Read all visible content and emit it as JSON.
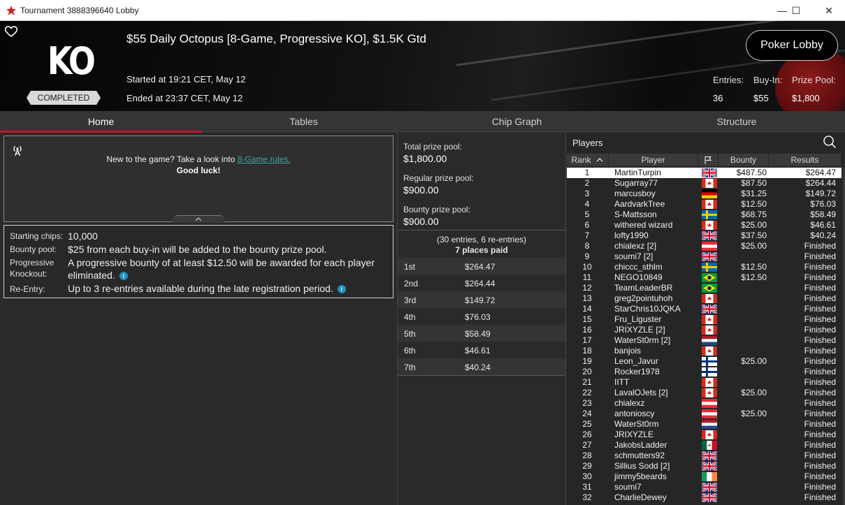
{
  "window": {
    "title": "Tournament 3888396640 Lobby",
    "minimize": "—",
    "maximize": "☐",
    "close": "✕"
  },
  "header": {
    "logo_text": "KO",
    "status": "COMPLETED",
    "tournament_name": "$55 Daily Octopus [8-Game, Progressive KO], $1.5K Gtd",
    "started": "Started at 19:21 CET, May 12",
    "ended": "Ended at 23:37 CET, May 12",
    "lobby_button": "Poker Lobby",
    "stats": [
      {
        "label": "Entries:",
        "value": "36"
      },
      {
        "label": "Buy-In:",
        "value": "$55"
      },
      {
        "label": "Prize Pool:",
        "value": "$1,800"
      }
    ]
  },
  "tabs": [
    {
      "label": "Home",
      "active": true
    },
    {
      "label": "Tables",
      "active": false
    },
    {
      "label": "Chip Graph",
      "active": false
    },
    {
      "label": "Structure",
      "active": false
    }
  ],
  "info": {
    "text_before": "New to the game? Take a look into ",
    "link": "8-Game rules.",
    "good_luck": "Good luck!"
  },
  "details": {
    "starting_chips_label": "Starting chips:",
    "starting_chips": "10,000",
    "bounty_pool_label": "Bounty pool:",
    "bounty_pool": "$25 from each buy-in will be added to the bounty prize pool.",
    "pko_label_1": "Progressive",
    "pko_label_2": "Knockout:",
    "pko_line1": "A progressive bounty of at least $12.50 will be awarded for each player",
    "pko_line2": "eliminated.",
    "reentry_label": "Re-Entry:",
    "reentry": "Up to 3 re-entries available during the late registration period.",
    "info_glyph": "i"
  },
  "prize": {
    "total_label": "Total prize pool:",
    "total": "$1,800.00",
    "regular_label": "Regular prize pool:",
    "regular": "$900.00",
    "bounty_label": "Bounty prize pool:",
    "bounty": "$900.00",
    "entries_note": "(30 entries, 6 re-entries)",
    "places_paid": "7 places paid",
    "places": [
      {
        "place": "1st",
        "amount": "$264.47"
      },
      {
        "place": "2nd",
        "amount": "$264.44"
      },
      {
        "place": "3rd",
        "amount": "$149.72"
      },
      {
        "place": "4th",
        "amount": "$76.03"
      },
      {
        "place": "5th",
        "amount": "$58.49"
      },
      {
        "place": "6th",
        "amount": "$46.61"
      },
      {
        "place": "7th",
        "amount": "$40.24"
      }
    ]
  },
  "players": {
    "title": "Players",
    "columns": {
      "rank": "Rank",
      "player": "Player",
      "bounty": "Bounty",
      "results": "Results"
    },
    "rows": [
      {
        "rank": "1",
        "name": "MartinTurpin",
        "flag": "uk",
        "bounty": "$487.50",
        "result": "$264.47"
      },
      {
        "rank": "2",
        "name": "Sugarray77",
        "flag": "ca",
        "bounty": "$87.50",
        "result": "$264.44"
      },
      {
        "rank": "3",
        "name": "marcusboy",
        "flag": "de",
        "bounty": "$31.25",
        "result": "$149.72"
      },
      {
        "rank": "4",
        "name": "AardvarkTree",
        "flag": "ca",
        "bounty": "$12.50",
        "result": "$76.03"
      },
      {
        "rank": "5",
        "name": "S-Mattsson",
        "flag": "se",
        "bounty": "$68.75",
        "result": "$58.49"
      },
      {
        "rank": "6",
        "name": "withered wizard",
        "flag": "ca",
        "bounty": "$25.00",
        "result": "$46.61"
      },
      {
        "rank": "7",
        "name": "lofty1990",
        "flag": "uk",
        "bounty": "$37.50",
        "result": "$40.24"
      },
      {
        "rank": "8",
        "name": "chialexz [2]",
        "flag": "at",
        "bounty": "$25.00",
        "result": "Finished"
      },
      {
        "rank": "9",
        "name": "soumi7 [2]",
        "flag": "uk",
        "bounty": "",
        "result": "Finished"
      },
      {
        "rank": "10",
        "name": "chiccc_sthlm",
        "flag": "se",
        "bounty": "$12.50",
        "result": "Finished"
      },
      {
        "rank": "11",
        "name": "NEGO10849",
        "flag": "br",
        "bounty": "$12.50",
        "result": "Finished"
      },
      {
        "rank": "12",
        "name": "TeamLeaderBR",
        "flag": "br",
        "bounty": "",
        "result": "Finished"
      },
      {
        "rank": "13",
        "name": "greg2pointuhoh",
        "flag": "ca",
        "bounty": "",
        "result": "Finished"
      },
      {
        "rank": "14",
        "name": "StarChris10JQKA",
        "flag": "uk",
        "bounty": "",
        "result": "Finished"
      },
      {
        "rank": "15",
        "name": "Fru_Liguster",
        "flag": "ca",
        "bounty": "",
        "result": "Finished"
      },
      {
        "rank": "16",
        "name": "JRIXYZLE [2]",
        "flag": "ca",
        "bounty": "",
        "result": "Finished"
      },
      {
        "rank": "17",
        "name": "WaterSt0rm [2]",
        "flag": "nl",
        "bounty": "",
        "result": "Finished"
      },
      {
        "rank": "18",
        "name": "banjois",
        "flag": "ca",
        "bounty": "",
        "result": "Finished"
      },
      {
        "rank": "19",
        "name": "Leon_Javur",
        "flag": "fi",
        "bounty": "$25.00",
        "result": "Finished"
      },
      {
        "rank": "20",
        "name": "Rocker1978",
        "flag": "fi",
        "bounty": "",
        "result": "Finished"
      },
      {
        "rank": "21",
        "name": "IITT",
        "flag": "ca",
        "bounty": "",
        "result": "Finished"
      },
      {
        "rank": "22",
        "name": "LavalOJets [2]",
        "flag": "ca",
        "bounty": "$25.00",
        "result": "Finished"
      },
      {
        "rank": "23",
        "name": "chialexz",
        "flag": "at",
        "bounty": "",
        "result": "Finished"
      },
      {
        "rank": "24",
        "name": "antonioscy",
        "flag": "at",
        "bounty": "$25.00",
        "result": "Finished"
      },
      {
        "rank": "25",
        "name": "WaterSt0rm",
        "flag": "nl",
        "bounty": "",
        "result": "Finished"
      },
      {
        "rank": "26",
        "name": "JRIXYZLE",
        "flag": "ca",
        "bounty": "",
        "result": "Finished"
      },
      {
        "rank": "27",
        "name": "JakobsLadder",
        "flag": "mx",
        "bounty": "",
        "result": "Finished"
      },
      {
        "rank": "28",
        "name": "schmutters92",
        "flag": "uk",
        "bounty": "",
        "result": "Finished"
      },
      {
        "rank": "29",
        "name": "Sillius Sodd [2]",
        "flag": "uk",
        "bounty": "",
        "result": "Finished"
      },
      {
        "rank": "30",
        "name": "jimmy5beards",
        "flag": "ie",
        "bounty": "",
        "result": "Finished"
      },
      {
        "rank": "31",
        "name": "soumi7",
        "flag": "uk",
        "bounty": "",
        "result": "Finished"
      },
      {
        "rank": "32",
        "name": "CharlieDewey",
        "flag": "uk",
        "bounty": "",
        "result": "Finished"
      }
    ]
  },
  "colors": {
    "accent": "#c8102e",
    "link": "#3aa7a0",
    "info": "#1e8fc0"
  }
}
